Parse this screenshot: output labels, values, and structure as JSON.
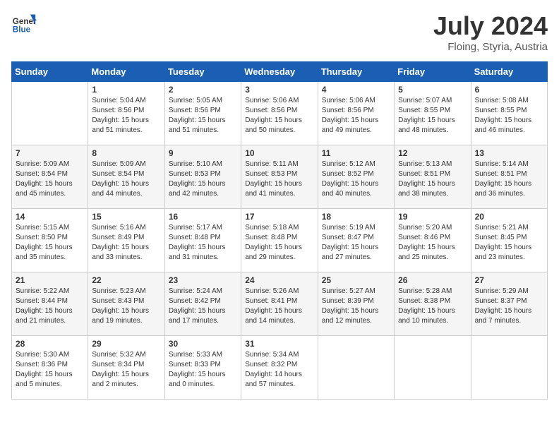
{
  "header": {
    "logo_line1": "General",
    "logo_line2": "Blue",
    "month_year": "July 2024",
    "location": "Floing, Styria, Austria"
  },
  "days_of_week": [
    "Sunday",
    "Monday",
    "Tuesday",
    "Wednesday",
    "Thursday",
    "Friday",
    "Saturday"
  ],
  "weeks": [
    [
      {
        "num": "",
        "sunrise": "",
        "sunset": "",
        "daylight": "",
        "empty": true
      },
      {
        "num": "1",
        "sunrise": "Sunrise: 5:04 AM",
        "sunset": "Sunset: 8:56 PM",
        "daylight": "Daylight: 15 hours and 51 minutes."
      },
      {
        "num": "2",
        "sunrise": "Sunrise: 5:05 AM",
        "sunset": "Sunset: 8:56 PM",
        "daylight": "Daylight: 15 hours and 51 minutes."
      },
      {
        "num": "3",
        "sunrise": "Sunrise: 5:06 AM",
        "sunset": "Sunset: 8:56 PM",
        "daylight": "Daylight: 15 hours and 50 minutes."
      },
      {
        "num": "4",
        "sunrise": "Sunrise: 5:06 AM",
        "sunset": "Sunset: 8:56 PM",
        "daylight": "Daylight: 15 hours and 49 minutes."
      },
      {
        "num": "5",
        "sunrise": "Sunrise: 5:07 AM",
        "sunset": "Sunset: 8:55 PM",
        "daylight": "Daylight: 15 hours and 48 minutes."
      },
      {
        "num": "6",
        "sunrise": "Sunrise: 5:08 AM",
        "sunset": "Sunset: 8:55 PM",
        "daylight": "Daylight: 15 hours and 46 minutes."
      }
    ],
    [
      {
        "num": "7",
        "sunrise": "Sunrise: 5:09 AM",
        "sunset": "Sunset: 8:54 PM",
        "daylight": "Daylight: 15 hours and 45 minutes."
      },
      {
        "num": "8",
        "sunrise": "Sunrise: 5:09 AM",
        "sunset": "Sunset: 8:54 PM",
        "daylight": "Daylight: 15 hours and 44 minutes."
      },
      {
        "num": "9",
        "sunrise": "Sunrise: 5:10 AM",
        "sunset": "Sunset: 8:53 PM",
        "daylight": "Daylight: 15 hours and 42 minutes."
      },
      {
        "num": "10",
        "sunrise": "Sunrise: 5:11 AM",
        "sunset": "Sunset: 8:53 PM",
        "daylight": "Daylight: 15 hours and 41 minutes."
      },
      {
        "num": "11",
        "sunrise": "Sunrise: 5:12 AM",
        "sunset": "Sunset: 8:52 PM",
        "daylight": "Daylight: 15 hours and 40 minutes."
      },
      {
        "num": "12",
        "sunrise": "Sunrise: 5:13 AM",
        "sunset": "Sunset: 8:51 PM",
        "daylight": "Daylight: 15 hours and 38 minutes."
      },
      {
        "num": "13",
        "sunrise": "Sunrise: 5:14 AM",
        "sunset": "Sunset: 8:51 PM",
        "daylight": "Daylight: 15 hours and 36 minutes."
      }
    ],
    [
      {
        "num": "14",
        "sunrise": "Sunrise: 5:15 AM",
        "sunset": "Sunset: 8:50 PM",
        "daylight": "Daylight: 15 hours and 35 minutes."
      },
      {
        "num": "15",
        "sunrise": "Sunrise: 5:16 AM",
        "sunset": "Sunset: 8:49 PM",
        "daylight": "Daylight: 15 hours and 33 minutes."
      },
      {
        "num": "16",
        "sunrise": "Sunrise: 5:17 AM",
        "sunset": "Sunset: 8:48 PM",
        "daylight": "Daylight: 15 hours and 31 minutes."
      },
      {
        "num": "17",
        "sunrise": "Sunrise: 5:18 AM",
        "sunset": "Sunset: 8:48 PM",
        "daylight": "Daylight: 15 hours and 29 minutes."
      },
      {
        "num": "18",
        "sunrise": "Sunrise: 5:19 AM",
        "sunset": "Sunset: 8:47 PM",
        "daylight": "Daylight: 15 hours and 27 minutes."
      },
      {
        "num": "19",
        "sunrise": "Sunrise: 5:20 AM",
        "sunset": "Sunset: 8:46 PM",
        "daylight": "Daylight: 15 hours and 25 minutes."
      },
      {
        "num": "20",
        "sunrise": "Sunrise: 5:21 AM",
        "sunset": "Sunset: 8:45 PM",
        "daylight": "Daylight: 15 hours and 23 minutes."
      }
    ],
    [
      {
        "num": "21",
        "sunrise": "Sunrise: 5:22 AM",
        "sunset": "Sunset: 8:44 PM",
        "daylight": "Daylight: 15 hours and 21 minutes."
      },
      {
        "num": "22",
        "sunrise": "Sunrise: 5:23 AM",
        "sunset": "Sunset: 8:43 PM",
        "daylight": "Daylight: 15 hours and 19 minutes."
      },
      {
        "num": "23",
        "sunrise": "Sunrise: 5:24 AM",
        "sunset": "Sunset: 8:42 PM",
        "daylight": "Daylight: 15 hours and 17 minutes."
      },
      {
        "num": "24",
        "sunrise": "Sunrise: 5:26 AM",
        "sunset": "Sunset: 8:41 PM",
        "daylight": "Daylight: 15 hours and 14 minutes."
      },
      {
        "num": "25",
        "sunrise": "Sunrise: 5:27 AM",
        "sunset": "Sunset: 8:39 PM",
        "daylight": "Daylight: 15 hours and 12 minutes."
      },
      {
        "num": "26",
        "sunrise": "Sunrise: 5:28 AM",
        "sunset": "Sunset: 8:38 PM",
        "daylight": "Daylight: 15 hours and 10 minutes."
      },
      {
        "num": "27",
        "sunrise": "Sunrise: 5:29 AM",
        "sunset": "Sunset: 8:37 PM",
        "daylight": "Daylight: 15 hours and 7 minutes."
      }
    ],
    [
      {
        "num": "28",
        "sunrise": "Sunrise: 5:30 AM",
        "sunset": "Sunset: 8:36 PM",
        "daylight": "Daylight: 15 hours and 5 minutes."
      },
      {
        "num": "29",
        "sunrise": "Sunrise: 5:32 AM",
        "sunset": "Sunset: 8:34 PM",
        "daylight": "Daylight: 15 hours and 2 minutes."
      },
      {
        "num": "30",
        "sunrise": "Sunrise: 5:33 AM",
        "sunset": "Sunset: 8:33 PM",
        "daylight": "Daylight: 15 hours and 0 minutes."
      },
      {
        "num": "31",
        "sunrise": "Sunrise: 5:34 AM",
        "sunset": "Sunset: 8:32 PM",
        "daylight": "Daylight: 14 hours and 57 minutes."
      },
      {
        "num": "",
        "sunrise": "",
        "sunset": "",
        "daylight": "",
        "empty": true
      },
      {
        "num": "",
        "sunrise": "",
        "sunset": "",
        "daylight": "",
        "empty": true
      },
      {
        "num": "",
        "sunrise": "",
        "sunset": "",
        "daylight": "",
        "empty": true
      }
    ]
  ]
}
